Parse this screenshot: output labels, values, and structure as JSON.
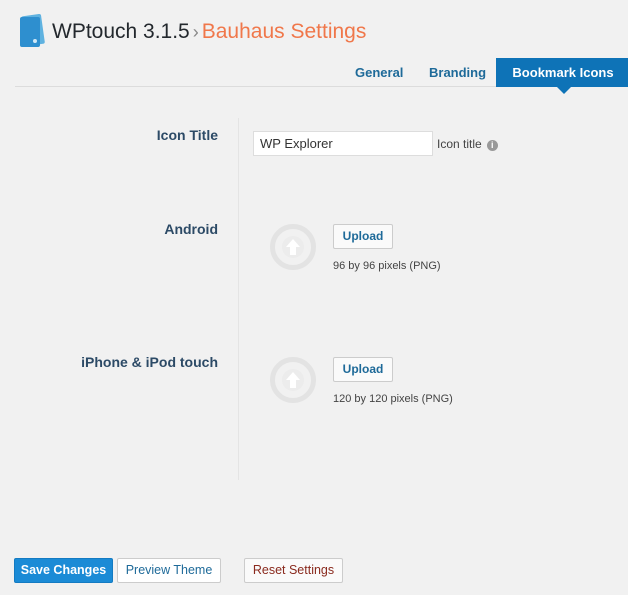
{
  "header": {
    "app_title": "WPtouch 3.1.5",
    "separator": "›",
    "page_title": "Bauhaus Settings"
  },
  "tabs": [
    {
      "label": "General"
    },
    {
      "label": "Branding"
    },
    {
      "label": "Bookmark Icons",
      "active": true
    }
  ],
  "icon_title": {
    "label": "Icon Title",
    "value": "WP Explorer",
    "hint": "Icon title",
    "info_symbol": "i"
  },
  "android": {
    "label": "Android",
    "button": "Upload",
    "note": "96 by 96 pixels (PNG)"
  },
  "iphone": {
    "label": "iPhone & iPod touch",
    "button": "Upload",
    "note": "120 by 120 pixels (PNG)"
  },
  "footer": {
    "save": "Save Changes",
    "preview": "Preview Theme",
    "reset": "Reset Settings"
  },
  "colors": {
    "accent": "#0e73b7",
    "brand_orange": "#f0774a",
    "save_button": "#1b8bd6",
    "reset_text": "#8a2a1e"
  }
}
